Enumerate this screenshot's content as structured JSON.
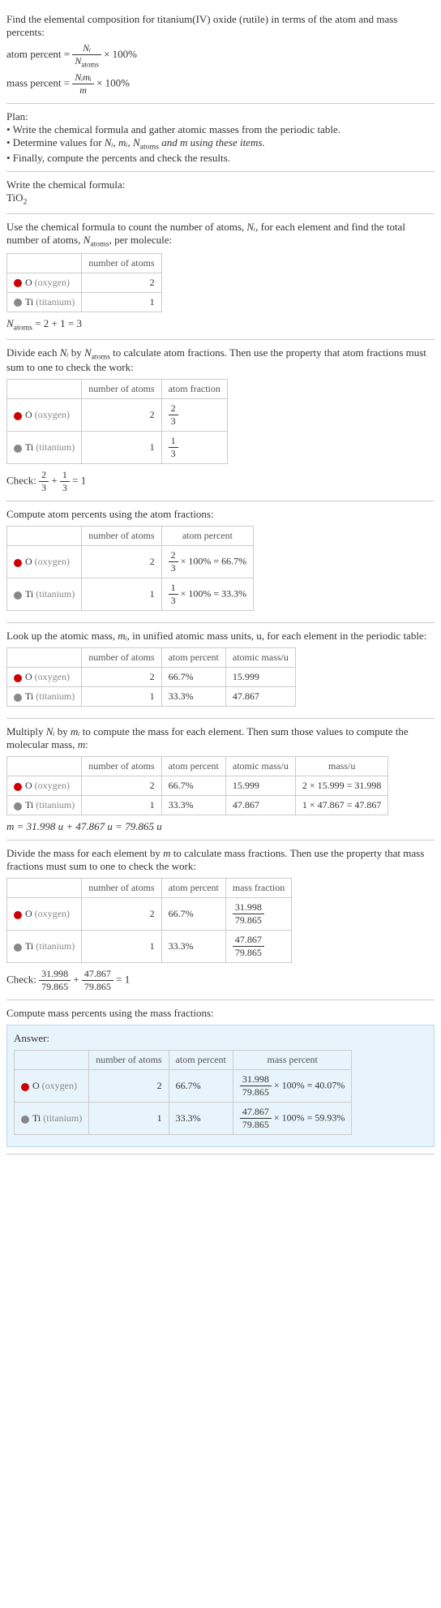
{
  "intro": {
    "line1": "Find the elemental composition for titanium(IV) oxide (rutile) in terms of the atom and mass percents:",
    "atom_percent_label": "atom percent =",
    "mass_percent_label": "mass percent =",
    "times100_a": "× 100%",
    "times100_b": "× 100%",
    "frac_a_num": "Nᵢ",
    "frac_a_den": "N",
    "frac_a_den_sub": "atoms",
    "frac_b_num": "Nᵢmᵢ",
    "frac_b_den": "m"
  },
  "plan": {
    "title": "Plan:",
    "b1": "• Write the chemical formula and gather atomic masses from the periodic table.",
    "b2_pre": "• Determine values for ",
    "b2_vars": "Nᵢ, mᵢ, N",
    "b2_sub": "atoms",
    "b2_post": " and m using these items.",
    "b3": "• Finally, compute the percents and check the results."
  },
  "formula": {
    "title": "Write the chemical formula:",
    "value": "TiO",
    "sub": "2"
  },
  "count": {
    "title_pre": "Use the chemical formula to count the number of atoms, ",
    "title_var": "Nᵢ",
    "title_mid": ", for each element and find the total number of atoms, ",
    "title_var2": "N",
    "title_sub": "atoms",
    "title_post": ", per molecule:",
    "h_num": "number of atoms",
    "o_label": "O",
    "o_name": "(oxygen)",
    "o_n": "2",
    "ti_label": "Ti",
    "ti_name": "(titanium)",
    "ti_n": "1",
    "sum_pre": "N",
    "sum_sub": "atoms",
    "sum_post": " = 2 + 1 = 3"
  },
  "atomfrac": {
    "title_pre": "Divide each ",
    "title_ni": "Nᵢ",
    "title_mid": " by ",
    "title_n": "N",
    "title_sub": "atoms",
    "title_post": " to calculate atom fractions. Then use the property that atom fractions must sum to one to check the work:",
    "h_num": "number of atoms",
    "h_frac": "atom fraction",
    "o_n": "2",
    "o_frac_num": "2",
    "o_frac_den": "3",
    "ti_n": "1",
    "ti_frac_num": "1",
    "ti_frac_den": "3",
    "check_pre": "Check: ",
    "check_eq": " = 1",
    "c1_num": "2",
    "c1_den": "3",
    "plus": " + ",
    "c2_num": "1",
    "c2_den": "3"
  },
  "atompct": {
    "title": "Compute atom percents using the atom fractions:",
    "h_num": "number of atoms",
    "h_pct": "atom percent",
    "o_n": "2",
    "o_frac_num": "2",
    "o_frac_den": "3",
    "o_pct": " × 100% = 66.7%",
    "ti_n": "1",
    "ti_frac_num": "1",
    "ti_frac_den": "3",
    "ti_pct": " × 100% = 33.3%"
  },
  "mass": {
    "title_pre": "Look up the atomic mass, ",
    "title_var": "mᵢ",
    "title_post": ", in unified atomic mass units, u, for each element in the periodic table:",
    "h_num": "number of atoms",
    "h_pct": "atom percent",
    "h_mass": "atomic mass/u",
    "o_n": "2",
    "o_pct": "66.7%",
    "o_m": "15.999",
    "ti_n": "1",
    "ti_pct": "33.3%",
    "ti_m": "47.867"
  },
  "molmass": {
    "title_pre": "Multiply ",
    "title_ni": "Nᵢ",
    "title_mid": " by ",
    "title_mi": "mᵢ",
    "title_post": " to compute the mass for each element. Then sum those values to compute the molecular mass, ",
    "title_m": "m",
    "title_colon": ":",
    "h_num": "number of atoms",
    "h_pct": "atom percent",
    "h_mass": "atomic mass/u",
    "h_mu": "mass/u",
    "o_n": "2",
    "o_pct": "66.7%",
    "o_m": "15.999",
    "o_mu": "2 × 15.999 = 31.998",
    "ti_n": "1",
    "ti_pct": "33.3%",
    "ti_m": "47.867",
    "ti_mu": "1 × 47.867 = 47.867",
    "sum": "m = 31.998 u + 47.867 u = 79.865 u"
  },
  "massfrac": {
    "title_pre": "Divide the mass for each element by ",
    "title_m": "m",
    "title_post": " to calculate mass fractions. Then use the property that mass fractions must sum to one to check the work:",
    "h_num": "number of atoms",
    "h_pct": "atom percent",
    "h_frac": "mass fraction",
    "o_n": "2",
    "o_pct": "66.7%",
    "o_num": "31.998",
    "o_den": "79.865",
    "ti_n": "1",
    "ti_pct": "33.3%",
    "ti_num": "47.867",
    "ti_den": "79.865",
    "check_pre": "Check: ",
    "c1_num": "31.998",
    "c1_den": "79.865",
    "plus": " + ",
    "c2_num": "47.867",
    "c2_den": "79.865",
    "check_eq": " = 1"
  },
  "masspct": {
    "title": "Compute mass percents using the mass fractions:",
    "answer": "Answer:",
    "h_num": "number of atoms",
    "h_pct": "atom percent",
    "h_mpct": "mass percent",
    "o_label": "O",
    "o_name": "(oxygen)",
    "o_n": "2",
    "o_pct": "66.7%",
    "o_num": "31.998",
    "o_den": "79.865",
    "o_res": " × 100% = 40.07%",
    "ti_label": "Ti",
    "ti_name": "(titanium)",
    "ti_n": "1",
    "ti_pct": "33.3%",
    "ti_num": "47.867",
    "ti_den": "79.865",
    "ti_res": " × 100% = 59.93%"
  }
}
